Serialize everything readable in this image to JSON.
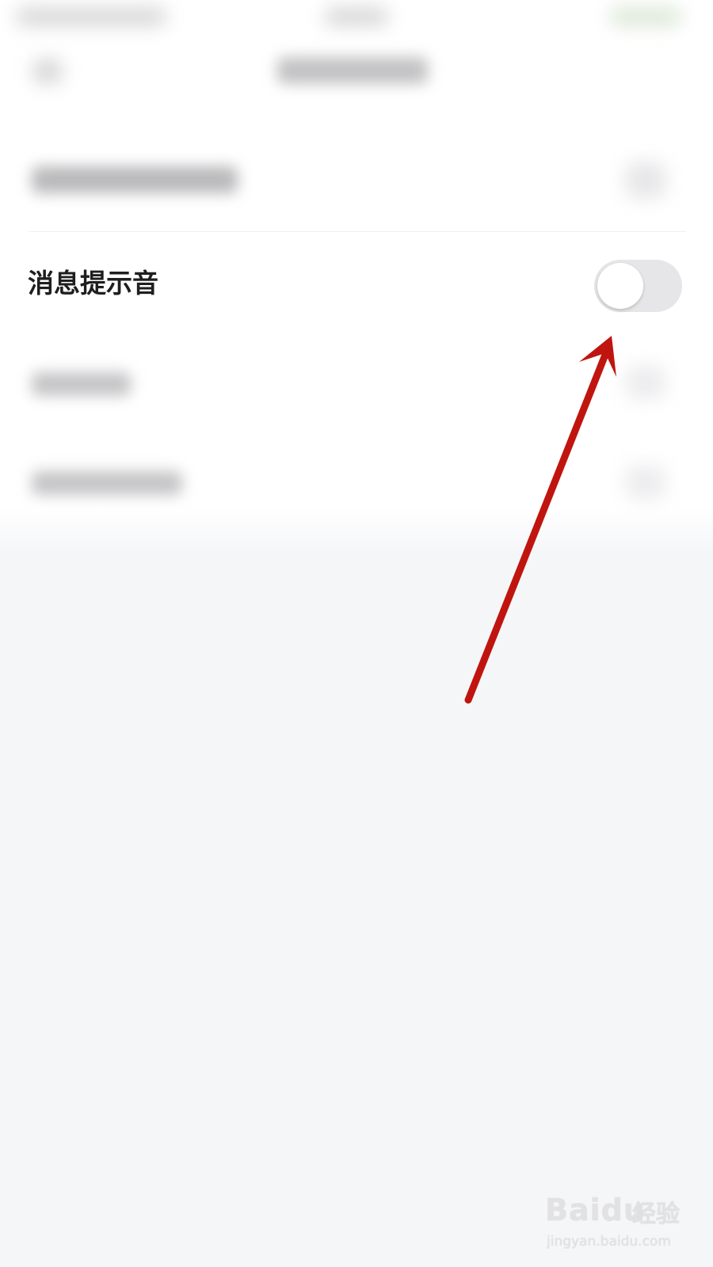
{
  "settings": {
    "message_sound_label": "消息提示音",
    "message_sound_enabled": false
  },
  "colors": {
    "arrow": "#c0150f",
    "toggle_off_track": "#e6e6e8",
    "background": "#f5f6f8"
  },
  "watermark": {
    "brand": "Baidu",
    "brand_cn": "经验",
    "url": "jingyan.baidu.com"
  }
}
